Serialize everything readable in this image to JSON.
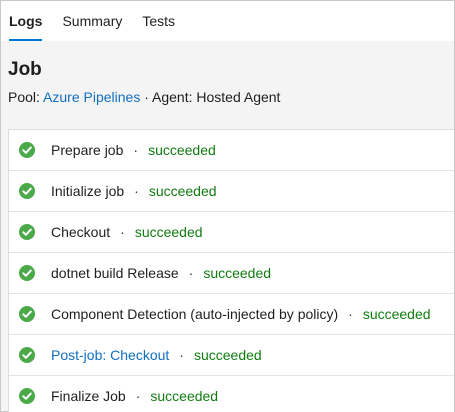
{
  "tabs": [
    {
      "label": "Logs",
      "active": true
    },
    {
      "label": "Summary",
      "active": false
    },
    {
      "label": "Tests",
      "active": false
    }
  ],
  "job": {
    "title": "Job",
    "pool_label": "Pool:",
    "pool_value": "Azure Pipelines",
    "separator": "·",
    "agent_text": "Agent: Hosted Agent"
  },
  "steps": [
    {
      "name": "Prepare job",
      "status": "succeeded"
    },
    {
      "name": "Initialize job",
      "status": "succeeded"
    },
    {
      "name": "Checkout",
      "status": "succeeded"
    },
    {
      "name": "dotnet build Release",
      "status": "succeeded"
    },
    {
      "name": "Component Detection (auto-injected by policy)",
      "status": "succeeded"
    },
    {
      "name": "Post-job: Checkout",
      "status": "succeeded"
    },
    {
      "name": "Finalize Job",
      "status": "succeeded"
    }
  ],
  "icons": {
    "step_status": "check-circle-icon"
  },
  "colors": {
    "success": "#107c10",
    "check_fill": "#4ca94a",
    "link": "#106ebe",
    "accent": "#0078d4"
  }
}
